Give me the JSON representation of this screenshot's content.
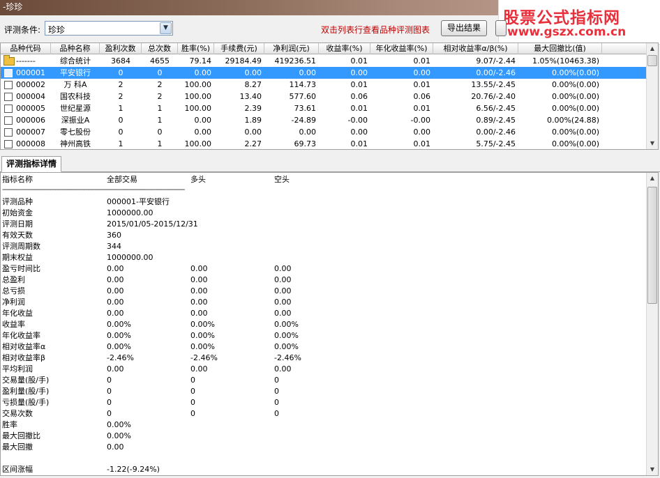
{
  "window": {
    "title": "-珍珍"
  },
  "watermark": {
    "title": "股票公式指标网",
    "url": "www.gszx.com.cn"
  },
  "toolbar": {
    "condition_label": "评测条件:",
    "condition_value": "珍珍",
    "hint": "双击列表行查看品种评测图表",
    "export_label": "导出结果"
  },
  "grid": {
    "columns": [
      "品种代码",
      "品种名称",
      "盈利次数",
      "总次数",
      "胜率(%)",
      "手续费(元)",
      "净利润(元)",
      "收益率(%)",
      "年化收益率(%)",
      "相对收益率α/β(%)",
      "最大回撤比(值)"
    ],
    "rows": [
      {
        "code": "-------",
        "name": "综合统计",
        "win": "3684",
        "total": "4655",
        "rate": "79.14",
        "fee": "29184.49",
        "profit": "419236.51",
        "ret": "0.01",
        "annual": "0.01",
        "rel": "9.07/-2.44",
        "dd": "1.05%(10463.38)",
        "icon": "folder",
        "selected": false
      },
      {
        "code": "000001",
        "name": "平安银行",
        "win": "0",
        "total": "0",
        "rate": "0.00",
        "fee": "0.00",
        "profit": "0.00",
        "ret": "0.00",
        "annual": "0.00",
        "rel": "0.00/-2.46",
        "dd": "0.00%(0.00)",
        "icon": "doc",
        "selected": true
      },
      {
        "code": "000002",
        "name": "万  科A",
        "win": "2",
        "total": "2",
        "rate": "100.00",
        "fee": "8.27",
        "profit": "114.73",
        "ret": "0.01",
        "annual": "0.01",
        "rel": "13.55/-2.45",
        "dd": "0.00%(0.00)",
        "icon": "doc",
        "selected": false
      },
      {
        "code": "000004",
        "name": "国农科技",
        "win": "2",
        "total": "2",
        "rate": "100.00",
        "fee": "13.40",
        "profit": "577.60",
        "ret": "0.06",
        "annual": "0.06",
        "rel": "20.76/-2.40",
        "dd": "0.00%(0.00)",
        "icon": "doc",
        "selected": false
      },
      {
        "code": "000005",
        "name": "世纪星源",
        "win": "1",
        "total": "1",
        "rate": "100.00",
        "fee": "2.39",
        "profit": "73.61",
        "ret": "0.01",
        "annual": "0.01",
        "rel": "6.56/-2.45",
        "dd": "0.00%(0.00)",
        "icon": "doc",
        "selected": false
      },
      {
        "code": "000006",
        "name": "深振业A",
        "win": "0",
        "total": "1",
        "rate": "0.00",
        "fee": "1.89",
        "profit": "-24.89",
        "ret": "-0.00",
        "annual": "-0.00",
        "rel": "0.89/-2.45",
        "dd": "0.00%(24.88)",
        "icon": "doc",
        "selected": false
      },
      {
        "code": "000007",
        "name": "零七股份",
        "win": "0",
        "total": "0",
        "rate": "0.00",
        "fee": "0.00",
        "profit": "0.00",
        "ret": "0.00",
        "annual": "0.00",
        "rel": "0.00/-2.46",
        "dd": "0.00%(0.00)",
        "icon": "doc",
        "selected": false
      },
      {
        "code": "000008",
        "name": "神州高铁",
        "win": "1",
        "total": "1",
        "rate": "100.00",
        "fee": "2.27",
        "profit": "69.73",
        "ret": "0.01",
        "annual": "0.01",
        "rel": "5.75/-2.45",
        "dd": "0.00%(0.00)",
        "icon": "doc",
        "selected": false
      }
    ]
  },
  "tabs": [
    {
      "label": "评测指标详情"
    }
  ],
  "detail": {
    "header": {
      "name": "指标名称",
      "all": "全部交易",
      "long": "多头",
      "short": "空头"
    },
    "separator": "----------------------------------------------------------------------------------------",
    "rows": [
      {
        "label": "评测品种",
        "all": "000001-平安银行",
        "long": "",
        "short": ""
      },
      {
        "label": "初始资金",
        "all": "1000000.00",
        "long": "",
        "short": ""
      },
      {
        "label": "评测日期",
        "all": "2015/01/05-2015/12/31",
        "long": "",
        "short": ""
      },
      {
        "label": "有效天数",
        "all": "360",
        "long": "",
        "short": ""
      },
      {
        "label": "评测周期数",
        "all": "344",
        "long": "",
        "short": ""
      },
      {
        "label": "期末权益",
        "all": "1000000.00",
        "long": "",
        "short": ""
      },
      {
        "label": "盈亏时间比",
        "all": "0.00",
        "long": "0.00",
        "short": "0.00"
      },
      {
        "label": "总盈利",
        "all": "0.00",
        "long": "0.00",
        "short": "0.00"
      },
      {
        "label": "总亏损",
        "all": "0.00",
        "long": "0.00",
        "short": "0.00"
      },
      {
        "label": "净利润",
        "all": "0.00",
        "long": "0.00",
        "short": "0.00"
      },
      {
        "label": "年化收益",
        "all": "0.00",
        "long": "0.00",
        "short": "0.00"
      },
      {
        "label": "收益率",
        "all": "0.00%",
        "long": "0.00%",
        "short": "0.00%"
      },
      {
        "label": "年化收益率",
        "all": "0.00%",
        "long": "0.00%",
        "short": "0.00%"
      },
      {
        "label": "相对收益率α",
        "all": "0.00%",
        "long": "0.00%",
        "short": "0.00%"
      },
      {
        "label": "相对收益率β",
        "all": "-2.46%",
        "long": "-2.46%",
        "short": "-2.46%"
      },
      {
        "label": "平均利润",
        "all": "0.00",
        "long": "0.00",
        "short": "0.00"
      },
      {
        "label": "交易量(股/手)",
        "all": "0",
        "long": "0",
        "short": "0"
      },
      {
        "label": "盈利量(股/手)",
        "all": "0",
        "long": "0",
        "short": "0"
      },
      {
        "label": "亏损量(股/手)",
        "all": "0",
        "long": "0",
        "short": "0"
      },
      {
        "label": "交易次数",
        "all": "0",
        "long": "0",
        "short": "0"
      },
      {
        "label": "胜率",
        "all": "0.00%",
        "long": "",
        "short": ""
      },
      {
        "label": "最大回撤比",
        "all": "0.00%",
        "long": "",
        "short": ""
      },
      {
        "label": "最大回撤",
        "all": "0.00",
        "long": "",
        "short": ""
      },
      {
        "label": "",
        "all": "",
        "long": "",
        "short": ""
      },
      {
        "label": "区间涨幅",
        "all": "-1.22(-9.24%)",
        "long": "",
        "short": ""
      }
    ]
  }
}
